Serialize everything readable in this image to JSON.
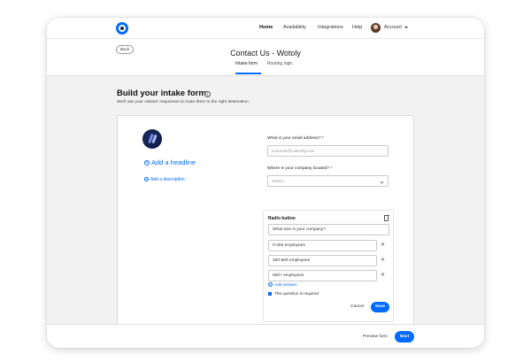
{
  "nav": {
    "items": [
      "Home",
      "Availability",
      "Integrations",
      "Help"
    ],
    "account_label": "Account"
  },
  "header": {
    "back_label": "Back",
    "title": "Contact Us - Wotoly",
    "tabs": [
      "Intake form",
      "Routing logic"
    ],
    "active_tab": "Intake form"
  },
  "main": {
    "title": "Build your intake form",
    "subtitle": "We'll use your visitors' responses to route them to the right destination"
  },
  "form_left": {
    "add_headline": "Add a headline",
    "add_description": "Add a description"
  },
  "form_fields": {
    "email_label": "What is your email address? *",
    "email_placeholder": "example@calendly.com",
    "location_label": "Where is your company located? *",
    "location_placeholder": "Select..."
  },
  "radio_panel": {
    "title": "Radio button",
    "question": "What size is your company?",
    "answers": [
      "0-250 employees",
      "250-500 employees",
      "500+ employees"
    ],
    "add_answer": "Add answer",
    "required_label": "This question is required",
    "required": true,
    "cancel_label": "Cancel",
    "save_label": "Save"
  },
  "footer": {
    "preview_label": "Preview form",
    "next_label": "Next"
  },
  "colors": {
    "accent": "#006bff"
  },
  "icons": [
    "calendly-logo-icon",
    "chevron-down-icon",
    "info-icon",
    "plus-circle-icon",
    "trash-icon",
    "close-icon",
    "checkbox-checked-icon"
  ]
}
